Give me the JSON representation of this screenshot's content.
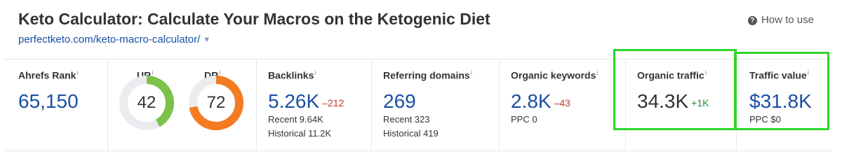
{
  "header": {
    "title": "Keto Calculator: Calculate Your Macros on the Ketogenic Diet",
    "url": "perfectketo.com/keto-macro-calculator/",
    "url_caret": "▼",
    "how_to_use": "How to use",
    "help_icon": "?"
  },
  "metrics": {
    "ahrefs_rank": {
      "label": "Ahrefs Rank",
      "info": "i",
      "value": "65,150"
    },
    "ur": {
      "label": "UR",
      "info": "i",
      "value": "42",
      "level": 0.42,
      "color": "#7cc24a"
    },
    "dr": {
      "label": "DR",
      "info": "i",
      "value": "72",
      "level": 0.72,
      "color": "#f47b20"
    },
    "backlinks": {
      "label": "Backlinks",
      "info": "i",
      "value": "5.26K",
      "delta": "–212",
      "recent": "Recent 9.64K",
      "historical": "Historical 11.2K"
    },
    "referring_domains": {
      "label": "Referring domains",
      "info": "i",
      "value": "269",
      "recent": "Recent 323",
      "historical": "Historical 419"
    },
    "organic_keywords": {
      "label": "Organic keywords",
      "info": "i",
      "value": "2.8K",
      "delta": "–43",
      "ppc": "PPC 0"
    },
    "organic_traffic": {
      "label": "Organic traffic",
      "info": "i",
      "value": "34.3K",
      "delta": "+1K"
    },
    "traffic_value": {
      "label": "Traffic value",
      "info": "i",
      "value": "$31.8K",
      "ppc": "PPC $0"
    }
  },
  "colors": {
    "link": "#1a4fa3",
    "highlight": "#2ad62a",
    "negative": "#c0392b",
    "positive": "#2e8b3a",
    "gauge_track": "#ececf0"
  }
}
